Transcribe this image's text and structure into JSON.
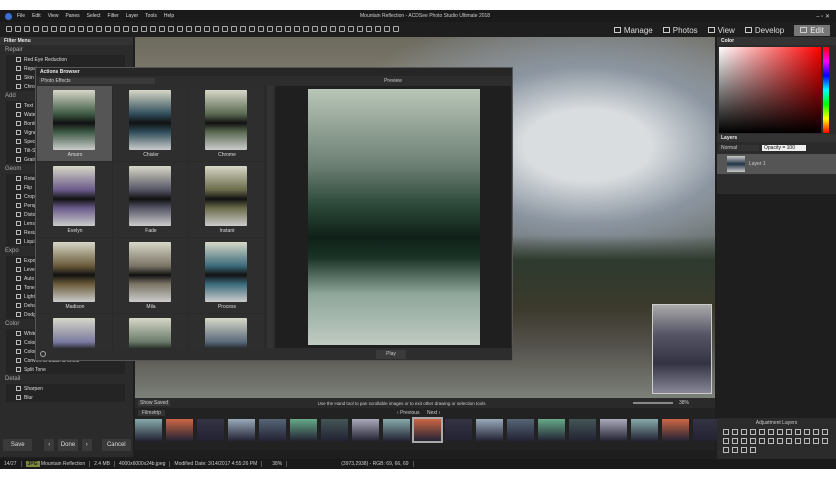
{
  "window": {
    "title": "Mountain Reflection - ACDSee Photo Studio Ultimate 2018"
  },
  "menu": [
    "File",
    "Edit",
    "View",
    "Panes",
    "Select",
    "Filter",
    "Layer",
    "Tools",
    "Help"
  ],
  "modes": [
    {
      "label": "Manage",
      "icon": "grid-icon"
    },
    {
      "label": "Photos",
      "icon": "photos-icon"
    },
    {
      "label": "View",
      "icon": "eye-icon"
    },
    {
      "label": "Develop",
      "icon": "develop-icon"
    },
    {
      "label": "Edit",
      "icon": "edit-icon",
      "active": true
    }
  ],
  "filter_menu": {
    "title": "Filter Menu",
    "sections": [
      {
        "name": "Repair",
        "items": [
          "Red Eye Reduction",
          "Repair",
          "Skin",
          "Chrom"
        ]
      },
      {
        "name": "Add",
        "items": [
          "Text",
          "Water",
          "Borde",
          "Vigne",
          "Speci",
          "Tilt-S",
          "Grain"
        ]
      },
      {
        "name": "Geom",
        "items": [
          "Rotat",
          "Flip",
          "Crop",
          "Persp",
          "Distor",
          "Lens",
          "Resiz",
          "Liqui"
        ]
      },
      {
        "name": "Expo",
        "items": [
          "Expo",
          "Level",
          "Auto",
          "Tone",
          "Light",
          "Dehaz",
          "Dodg"
        ]
      },
      {
        "name": "Color",
        "items": [
          "White",
          "Color EQ",
          "Color Balance",
          "Convert to Black & White",
          "Split Tone"
        ]
      },
      {
        "name": "Detail",
        "items": [
          "Sharpen",
          "Blur"
        ]
      }
    ],
    "buttons": {
      "save": "Save",
      "done": "Done",
      "cancel": "Cancel"
    }
  },
  "actions_browser": {
    "title": "Actions Browser",
    "category": "Photo Effects",
    "preview_title": "Preview",
    "play": "Play",
    "effects": [
      "Amaro",
      "Chisler",
      "Chrome",
      "Evelyn",
      "Fade",
      "Instant",
      "Madison",
      "Mila",
      "Process",
      "",
      "",
      ""
    ]
  },
  "canvas_status": {
    "show_saved": "Show Saved",
    "hint": "Use the Hand tool to pan scrollable images or to exit other drawing or selection tools",
    "zoom": "38%"
  },
  "filmstrip": {
    "title": "Filmstrip",
    "previous": "Previous",
    "next": "Next"
  },
  "color_panel": {
    "title": "Color"
  },
  "layers": {
    "title": "Layers",
    "blend": "Normal",
    "opacity": "Opacity = 100",
    "layer": "Layer 1"
  },
  "adjustment_layers": {
    "title": "Adjustment Layers"
  },
  "status": {
    "index": "14/27",
    "badge": "JPG",
    "name": "Mountain Reflection",
    "size": "2.4 MB",
    "dims": "4000x6000x24b.jpeg",
    "modified": "Modified Date: 3/14/2017 4:55:26 PM",
    "zoom": "38%",
    "coords": "(3973,2938) - RGB: 69, 66, 69"
  }
}
